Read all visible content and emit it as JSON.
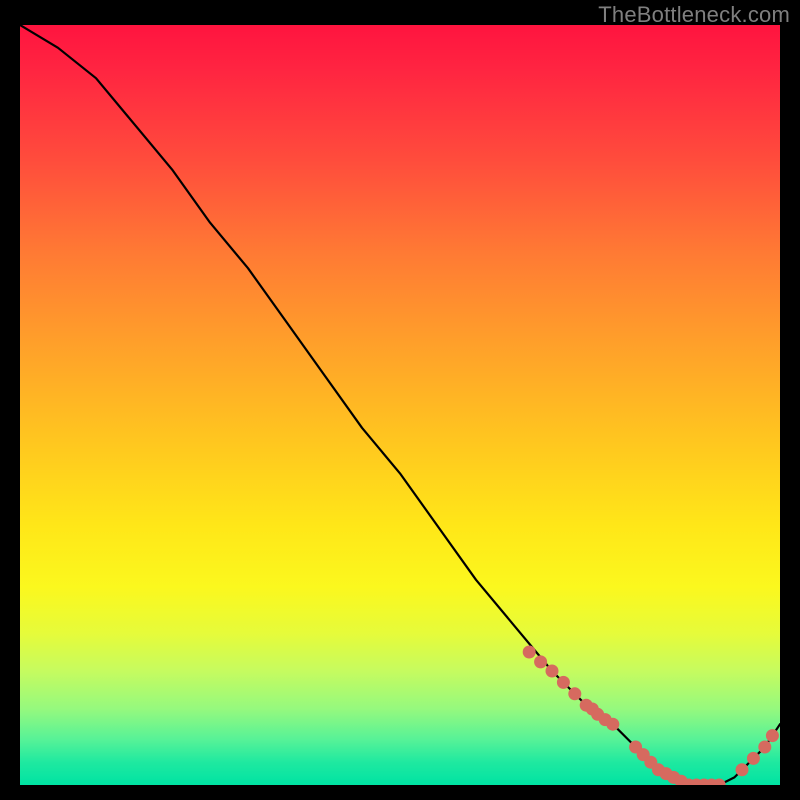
{
  "watermark": "TheBottleneck.com",
  "colors": {
    "marker": "#d66a5f",
    "curve": "#000000",
    "page_bg": "#000000",
    "gradient_top": "#ff143f",
    "gradient_bottom": "#00e3a3"
  },
  "chart_data": {
    "type": "line",
    "title": "",
    "xlabel": "",
    "ylabel": "",
    "xlim": [
      0,
      100
    ],
    "ylim": [
      0,
      100
    ],
    "grid": false,
    "legend": false,
    "description": "Bottleneck curve: starts at 100% on the left, drops steeply to near 0% around x≈85, stays flat, then rises slightly toward the right edge.",
    "series": [
      {
        "name": "bottleneck-curve",
        "x": [
          0,
          5,
          10,
          15,
          20,
          25,
          30,
          35,
          40,
          45,
          50,
          55,
          60,
          65,
          70,
          75,
          78,
          80,
          82,
          84,
          86,
          88,
          90,
          92,
          94,
          96,
          98,
          100
        ],
        "values": [
          100,
          97,
          93,
          87,
          81,
          74,
          68,
          61,
          54,
          47,
          41,
          34,
          27,
          21,
          15,
          10,
          8,
          6,
          4,
          2,
          1,
          0,
          0,
          0,
          1,
          3,
          5,
          8
        ]
      }
    ],
    "markers": [
      {
        "x_range": [
          67,
          78
        ],
        "count": 10,
        "note": "cluster on descending slope"
      },
      {
        "x_range": [
          81,
          92
        ],
        "count": 12,
        "note": "cluster at flat minimum"
      },
      {
        "x_range": [
          95,
          99
        ],
        "count": 4,
        "note": "cluster on rising tail"
      }
    ],
    "marker_points": [
      {
        "x": 67.0,
        "y": 17.5
      },
      {
        "x": 68.5,
        "y": 16.2
      },
      {
        "x": 70.0,
        "y": 15.0
      },
      {
        "x": 71.5,
        "y": 13.5
      },
      {
        "x": 73.0,
        "y": 12.0
      },
      {
        "x": 74.5,
        "y": 10.5
      },
      {
        "x": 75.3,
        "y": 10.0
      },
      {
        "x": 76.0,
        "y": 9.3
      },
      {
        "x": 77.0,
        "y": 8.6
      },
      {
        "x": 78.0,
        "y": 8.0
      },
      {
        "x": 81.0,
        "y": 5.0
      },
      {
        "x": 82.0,
        "y": 4.0
      },
      {
        "x": 83.0,
        "y": 3.0
      },
      {
        "x": 84.0,
        "y": 2.0
      },
      {
        "x": 85.0,
        "y": 1.5
      },
      {
        "x": 86.0,
        "y": 1.0
      },
      {
        "x": 87.0,
        "y": 0.5
      },
      {
        "x": 88.0,
        "y": 0.0
      },
      {
        "x": 89.0,
        "y": 0.0
      },
      {
        "x": 90.0,
        "y": 0.0
      },
      {
        "x": 91.0,
        "y": 0.0
      },
      {
        "x": 92.0,
        "y": 0.0
      },
      {
        "x": 95.0,
        "y": 2.0
      },
      {
        "x": 96.5,
        "y": 3.5
      },
      {
        "x": 98.0,
        "y": 5.0
      },
      {
        "x": 99.0,
        "y": 6.5
      }
    ]
  }
}
